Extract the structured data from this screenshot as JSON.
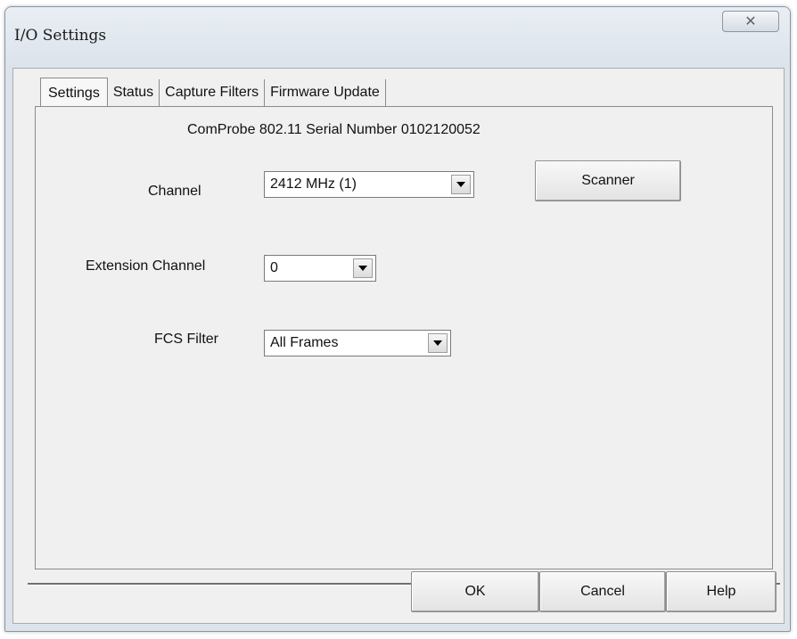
{
  "window": {
    "title": "I/O Settings",
    "close_glyph": "✕"
  },
  "tabs": [
    {
      "label": "Settings",
      "active": true
    },
    {
      "label": "Status",
      "active": false
    },
    {
      "label": "Capture Filters",
      "active": false
    },
    {
      "label": "Firmware Update",
      "active": false
    }
  ],
  "settings": {
    "serial_text": "ComProbe 802.11 Serial Number 0102120052",
    "channel": {
      "label": "Channel",
      "value": "2412 MHz (1)"
    },
    "extension_channel": {
      "label": "Extension Channel",
      "value": "0"
    },
    "fcs_filter": {
      "label": "FCS Filter",
      "value": "All Frames"
    },
    "scanner_label": "Scanner"
  },
  "footer": {
    "ok_label": "OK",
    "cancel_label": "Cancel",
    "help_label": "Help"
  }
}
